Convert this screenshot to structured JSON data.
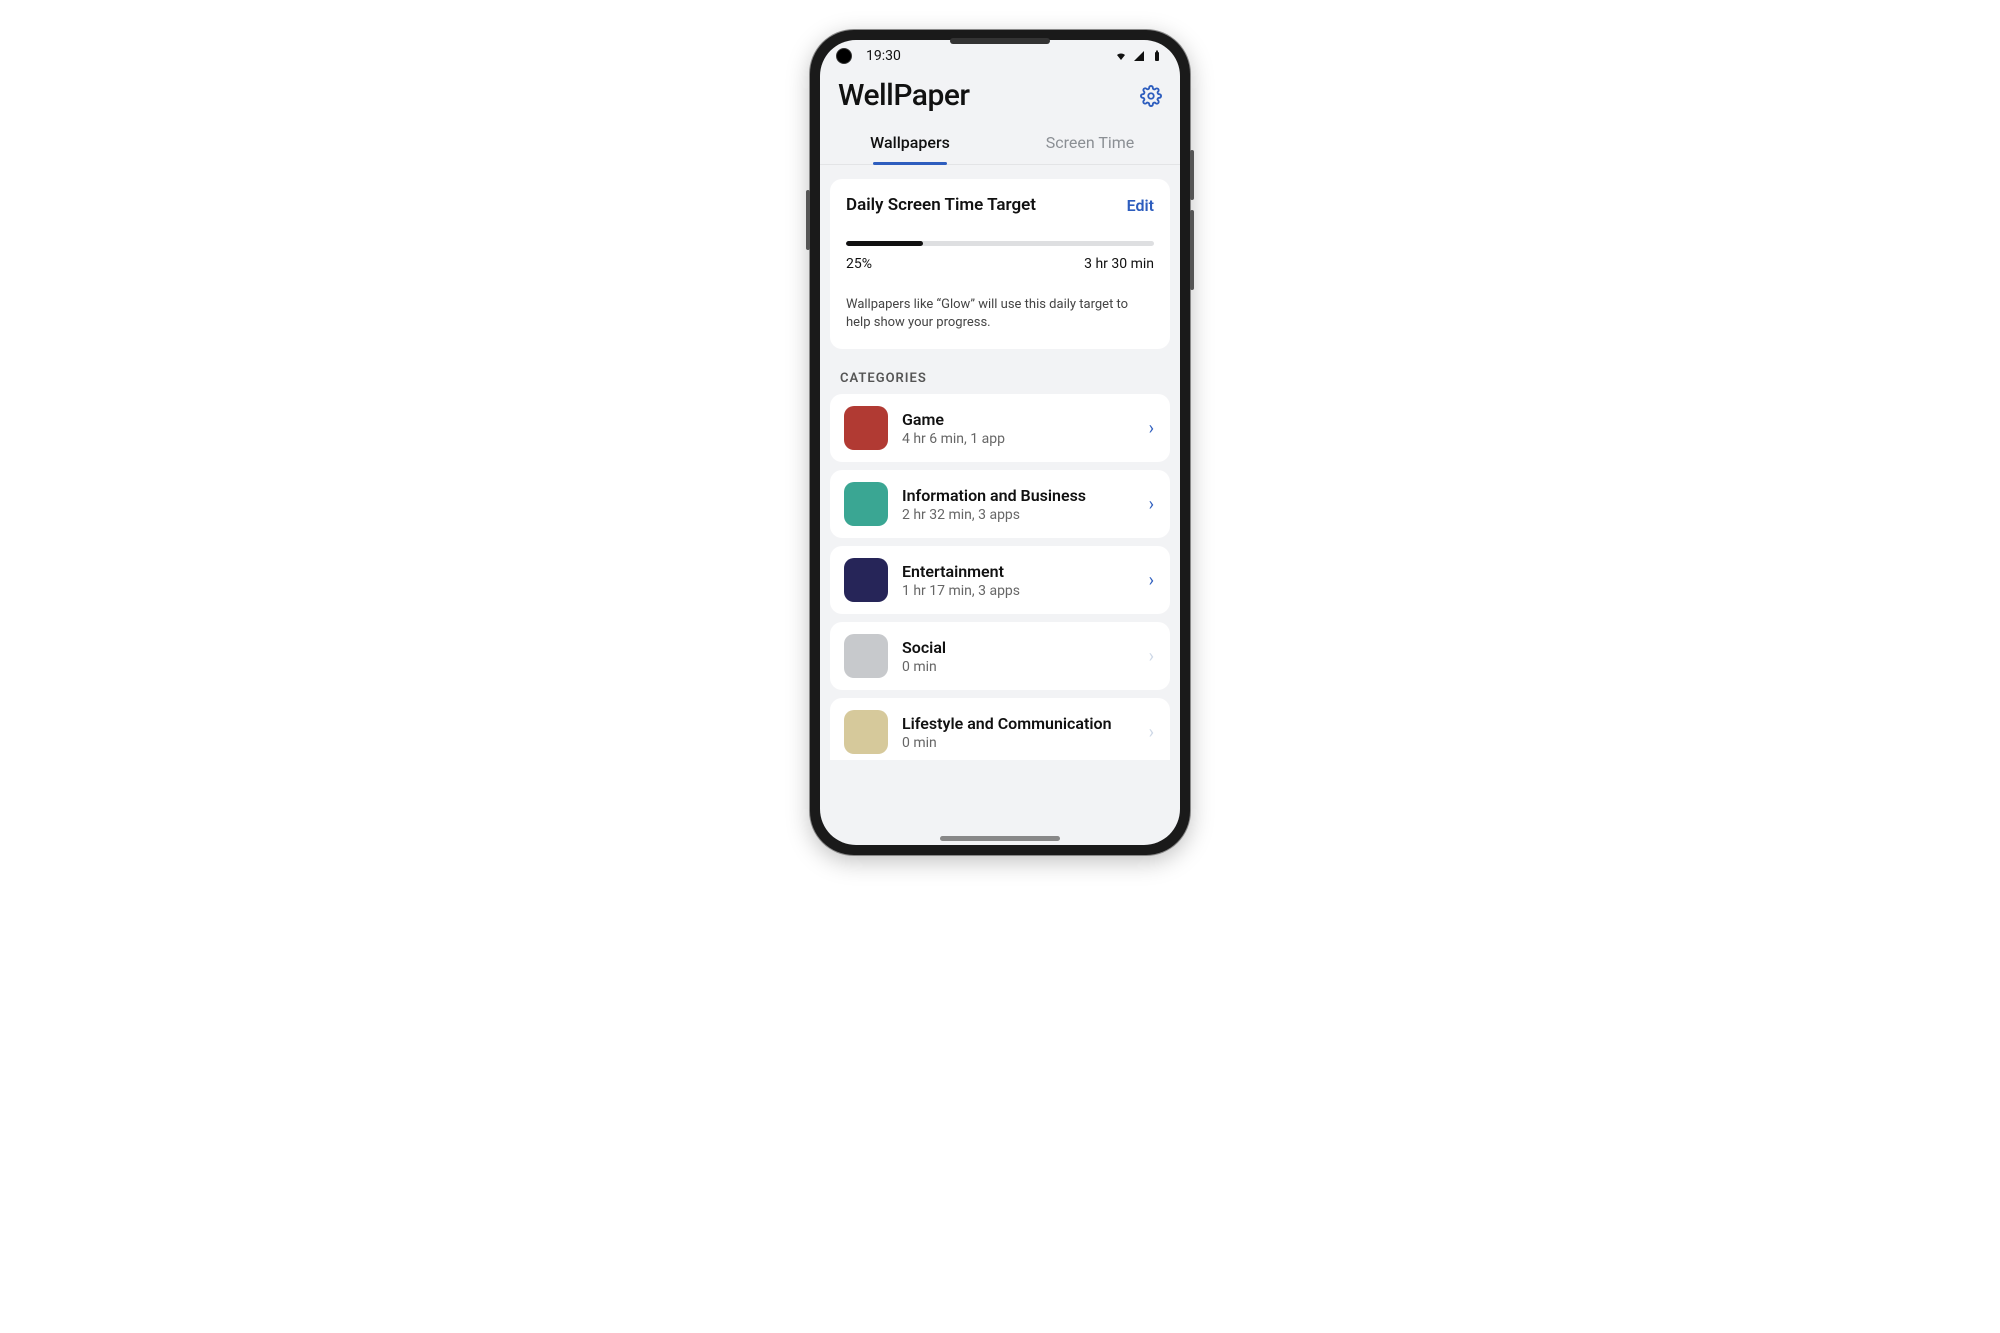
{
  "status": {
    "time": "19:30"
  },
  "app": {
    "title": "WellPaper"
  },
  "tabs": [
    {
      "label": "Wallpapers",
      "active": true
    },
    {
      "label": "Screen Time",
      "active": false
    }
  ],
  "target_card": {
    "title": "Daily Screen Time Target",
    "edit_label": "Edit",
    "progress_percent_label": "25%",
    "progress_percent_value": 25,
    "duration_label": "3 hr 30 min",
    "description": "Wallpapers like “Glow” will use this daily target to help show your progress."
  },
  "categories_header": "CATEGORIES",
  "categories": [
    {
      "name": "Game",
      "sub": "4 hr 6 min, 1 app",
      "color": "#b13a33",
      "active": true
    },
    {
      "name": "Information and Business",
      "sub": "2 hr 32 min, 3 apps",
      "color": "#3aa693",
      "active": true
    },
    {
      "name": "Entertainment",
      "sub": "1 hr 17 min, 3 apps",
      "color": "#262558",
      "active": true
    },
    {
      "name": "Social",
      "sub": "0 min",
      "color": "#c7c9cc",
      "active": false
    },
    {
      "name": "Lifestyle and Communication",
      "sub": "0 min",
      "color": "#d6c99b",
      "active": false
    }
  ]
}
